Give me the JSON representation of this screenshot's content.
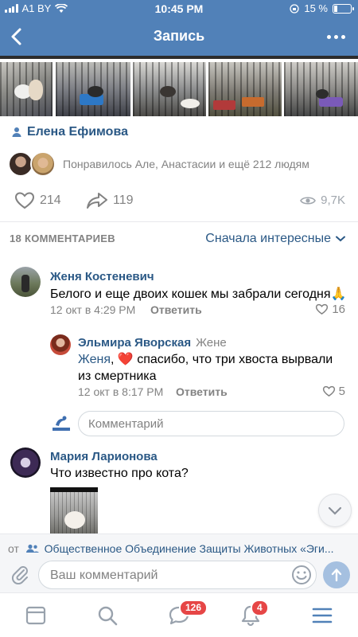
{
  "status_bar": {
    "carrier": "A1 BY",
    "time": "10:45 PM",
    "battery": "15 %"
  },
  "header": {
    "title": "Запись"
  },
  "post": {
    "author": "Елена Ефимова",
    "likers_text": "Понравилось Але, Анастасии и ещё 212 людям",
    "likes": "214",
    "shares": "119",
    "views": "9,7K"
  },
  "comments_section": {
    "count_label": "18 КОММЕНТАРИЕВ",
    "sort_label": "Сначала интересные"
  },
  "comments": [
    {
      "name": "Женя Костеневич",
      "text": "Белого и еще двоих кошек мы забрали сегодня🙏",
      "date": "12 окт в 4:29 PM",
      "reply_label": "Ответить",
      "likes": "16"
    },
    {
      "name": "Эльмира Яворская",
      "reply_to": "Жене",
      "mention": "Женя",
      "text_line1": ", ❤️ спасибо, что три хвоста вырвали",
      "text_line2": "из смертника",
      "date": "12 окт в 8:17 PM",
      "reply_label": "Ответить",
      "likes": "5"
    },
    {
      "name": "Мария Ларионова",
      "text": "Что известно про кота?"
    }
  ],
  "subreply_placeholder": "Комментарий",
  "from_line": {
    "label": "от",
    "group": "Общественное Объединение Защиты Животных «Эги..."
  },
  "input": {
    "placeholder": "Ваш комментарий"
  },
  "tabbar": {
    "messages_badge": "126",
    "notifications_badge": "4"
  },
  "colors": {
    "brand": "#5181b8",
    "link": "#2a5885",
    "secondary_text": "#828282",
    "badge": "#e64646"
  },
  "icons": [
    "back-arrow-icon",
    "more-icon",
    "user-icon",
    "heart-icon",
    "share-icon",
    "eye-icon",
    "chevron-down-icon",
    "attach-icon",
    "smile-icon",
    "send-icon",
    "news-icon",
    "search-icon",
    "messages-icon",
    "bell-icon",
    "menu-icon"
  ]
}
